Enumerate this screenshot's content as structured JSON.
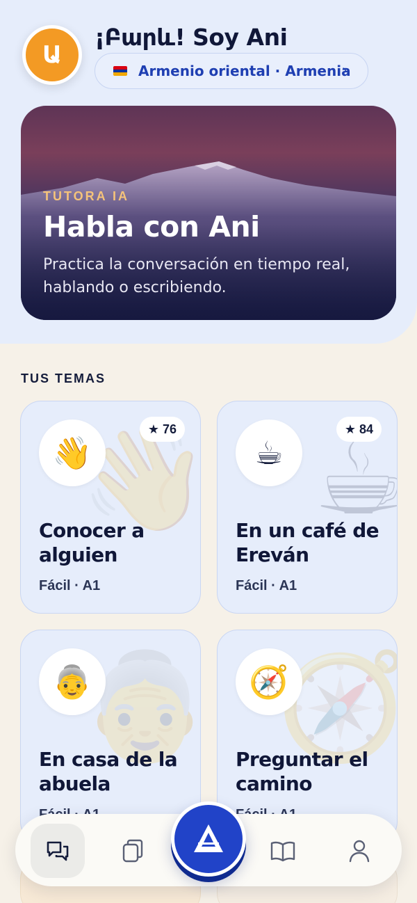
{
  "header": {
    "avatar_letter": "Ա",
    "greeting": "¡Բարև! Soy Ani",
    "language_label": "Armenio oriental · Armenia",
    "flag_colors": [
      "#d90012",
      "#0033a0",
      "#f2a800"
    ]
  },
  "hero": {
    "kicker": "TUTORA IA",
    "title": "Habla con Ani",
    "subtitle": "Practica la conversación en tiempo real, hablando o escribiendo."
  },
  "topics": {
    "section_label": "TUS TEMAS",
    "items": [
      {
        "emoji": "👋",
        "stars": "76",
        "title": "Conocer a alguien",
        "meta": "Fácil · A1"
      },
      {
        "emoji": "☕",
        "stars": "84",
        "title": "En un café de Ereván",
        "meta": "Fácil · A1"
      },
      {
        "emoji": "👵",
        "stars": "",
        "title": "En casa de la abuela",
        "meta": "Fácil · A1"
      },
      {
        "emoji": "🧭",
        "stars": "",
        "title": "Preguntar el camino",
        "meta": "Fácil · A1"
      }
    ]
  },
  "nav": {
    "items": [
      "chat-icon",
      "cards-icon",
      "home-logo-icon",
      "book-icon",
      "profile-icon"
    ],
    "active": "chat-icon",
    "accent_color": "#2143c8"
  }
}
